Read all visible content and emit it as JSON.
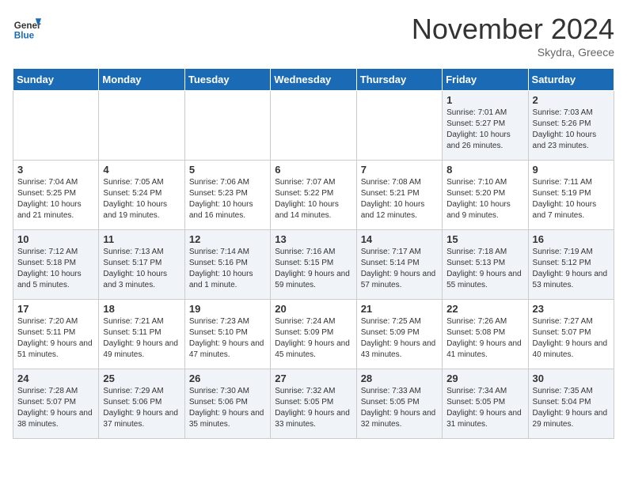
{
  "header": {
    "logo_line1": "General",
    "logo_line2": "Blue",
    "month": "November 2024",
    "location": "Skydra, Greece"
  },
  "days_of_week": [
    "Sunday",
    "Monday",
    "Tuesday",
    "Wednesday",
    "Thursday",
    "Friday",
    "Saturday"
  ],
  "weeks": [
    [
      {
        "day": "",
        "info": ""
      },
      {
        "day": "",
        "info": ""
      },
      {
        "day": "",
        "info": ""
      },
      {
        "day": "",
        "info": ""
      },
      {
        "day": "",
        "info": ""
      },
      {
        "day": "1",
        "info": "Sunrise: 7:01 AM\nSunset: 5:27 PM\nDaylight: 10 hours and 26 minutes."
      },
      {
        "day": "2",
        "info": "Sunrise: 7:03 AM\nSunset: 5:26 PM\nDaylight: 10 hours and 23 minutes."
      }
    ],
    [
      {
        "day": "3",
        "info": "Sunrise: 7:04 AM\nSunset: 5:25 PM\nDaylight: 10 hours and 21 minutes."
      },
      {
        "day": "4",
        "info": "Sunrise: 7:05 AM\nSunset: 5:24 PM\nDaylight: 10 hours and 19 minutes."
      },
      {
        "day": "5",
        "info": "Sunrise: 7:06 AM\nSunset: 5:23 PM\nDaylight: 10 hours and 16 minutes."
      },
      {
        "day": "6",
        "info": "Sunrise: 7:07 AM\nSunset: 5:22 PM\nDaylight: 10 hours and 14 minutes."
      },
      {
        "day": "7",
        "info": "Sunrise: 7:08 AM\nSunset: 5:21 PM\nDaylight: 10 hours and 12 minutes."
      },
      {
        "day": "8",
        "info": "Sunrise: 7:10 AM\nSunset: 5:20 PM\nDaylight: 10 hours and 9 minutes."
      },
      {
        "day": "9",
        "info": "Sunrise: 7:11 AM\nSunset: 5:19 PM\nDaylight: 10 hours and 7 minutes."
      }
    ],
    [
      {
        "day": "10",
        "info": "Sunrise: 7:12 AM\nSunset: 5:18 PM\nDaylight: 10 hours and 5 minutes."
      },
      {
        "day": "11",
        "info": "Sunrise: 7:13 AM\nSunset: 5:17 PM\nDaylight: 10 hours and 3 minutes."
      },
      {
        "day": "12",
        "info": "Sunrise: 7:14 AM\nSunset: 5:16 PM\nDaylight: 10 hours and 1 minute."
      },
      {
        "day": "13",
        "info": "Sunrise: 7:16 AM\nSunset: 5:15 PM\nDaylight: 9 hours and 59 minutes."
      },
      {
        "day": "14",
        "info": "Sunrise: 7:17 AM\nSunset: 5:14 PM\nDaylight: 9 hours and 57 minutes."
      },
      {
        "day": "15",
        "info": "Sunrise: 7:18 AM\nSunset: 5:13 PM\nDaylight: 9 hours and 55 minutes."
      },
      {
        "day": "16",
        "info": "Sunrise: 7:19 AM\nSunset: 5:12 PM\nDaylight: 9 hours and 53 minutes."
      }
    ],
    [
      {
        "day": "17",
        "info": "Sunrise: 7:20 AM\nSunset: 5:11 PM\nDaylight: 9 hours and 51 minutes."
      },
      {
        "day": "18",
        "info": "Sunrise: 7:21 AM\nSunset: 5:11 PM\nDaylight: 9 hours and 49 minutes."
      },
      {
        "day": "19",
        "info": "Sunrise: 7:23 AM\nSunset: 5:10 PM\nDaylight: 9 hours and 47 minutes."
      },
      {
        "day": "20",
        "info": "Sunrise: 7:24 AM\nSunset: 5:09 PM\nDaylight: 9 hours and 45 minutes."
      },
      {
        "day": "21",
        "info": "Sunrise: 7:25 AM\nSunset: 5:09 PM\nDaylight: 9 hours and 43 minutes."
      },
      {
        "day": "22",
        "info": "Sunrise: 7:26 AM\nSunset: 5:08 PM\nDaylight: 9 hours and 41 minutes."
      },
      {
        "day": "23",
        "info": "Sunrise: 7:27 AM\nSunset: 5:07 PM\nDaylight: 9 hours and 40 minutes."
      }
    ],
    [
      {
        "day": "24",
        "info": "Sunrise: 7:28 AM\nSunset: 5:07 PM\nDaylight: 9 hours and 38 minutes."
      },
      {
        "day": "25",
        "info": "Sunrise: 7:29 AM\nSunset: 5:06 PM\nDaylight: 9 hours and 37 minutes."
      },
      {
        "day": "26",
        "info": "Sunrise: 7:30 AM\nSunset: 5:06 PM\nDaylight: 9 hours and 35 minutes."
      },
      {
        "day": "27",
        "info": "Sunrise: 7:32 AM\nSunset: 5:05 PM\nDaylight: 9 hours and 33 minutes."
      },
      {
        "day": "28",
        "info": "Sunrise: 7:33 AM\nSunset: 5:05 PM\nDaylight: 9 hours and 32 minutes."
      },
      {
        "day": "29",
        "info": "Sunrise: 7:34 AM\nSunset: 5:05 PM\nDaylight: 9 hours and 31 minutes."
      },
      {
        "day": "30",
        "info": "Sunrise: 7:35 AM\nSunset: 5:04 PM\nDaylight: 9 hours and 29 minutes."
      }
    ]
  ]
}
